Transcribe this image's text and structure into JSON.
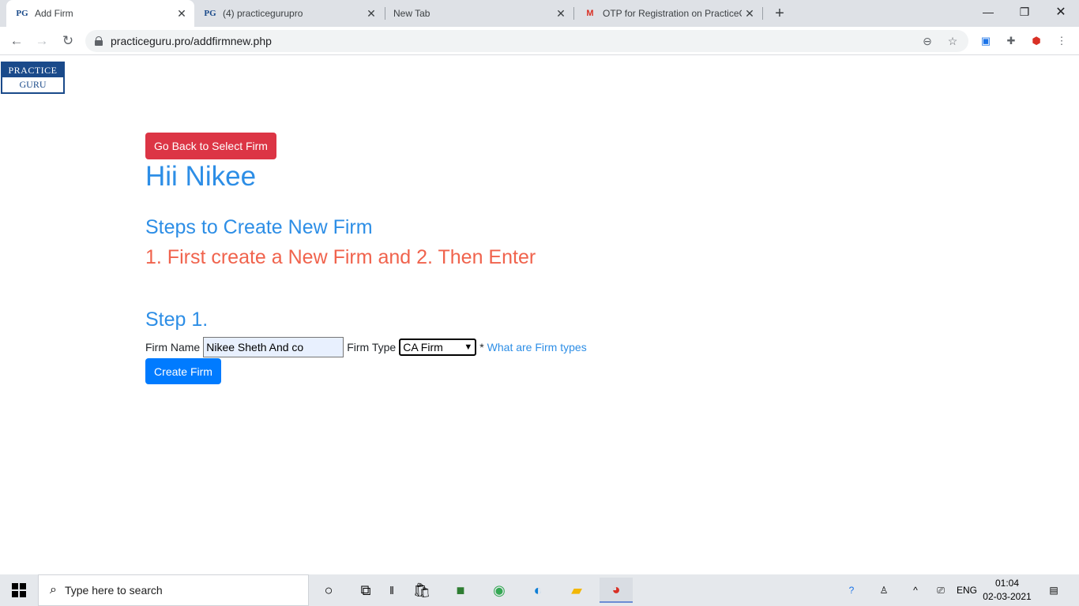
{
  "browser": {
    "tabs": [
      {
        "favicon": "PG",
        "title": "Add Firm",
        "active": true
      },
      {
        "favicon": "PG",
        "title": "(4) practicegurupro",
        "active": false
      },
      {
        "favicon": "",
        "title": "New Tab",
        "active": false
      },
      {
        "favicon": "M",
        "title": "OTP for Registration on PracticeG",
        "active": false
      }
    ],
    "url": "practiceguru.pro/addfirmnew.php"
  },
  "page": {
    "logo_top": "PRACTICE",
    "logo_bottom": "GURU",
    "back_button": "Go Back to Select Firm",
    "greeting": "Hii Nikee",
    "steps_heading": "Steps to Create New Firm",
    "steps_sub": "1. First create a New Firm and 2. Then Enter",
    "step1_heading": "Step 1.",
    "firm_name_label": "Firm Name",
    "firm_name_value": "Nikee Sheth And co",
    "firm_type_label": "Firm Type",
    "firm_type_value": "CA Firm",
    "required_mark": "*",
    "firm_types_link": "What are Firm types",
    "create_button": "Create Firm"
  },
  "taskbar": {
    "search_placeholder": "Type here to search",
    "language": "ENG",
    "time": "01:04",
    "date": "02-03-2021"
  },
  "colors": {
    "heading_blue": "#2d8ee6",
    "accent_red": "#dc3545",
    "step_orange": "#f0634d",
    "primary_button": "#007bff"
  }
}
